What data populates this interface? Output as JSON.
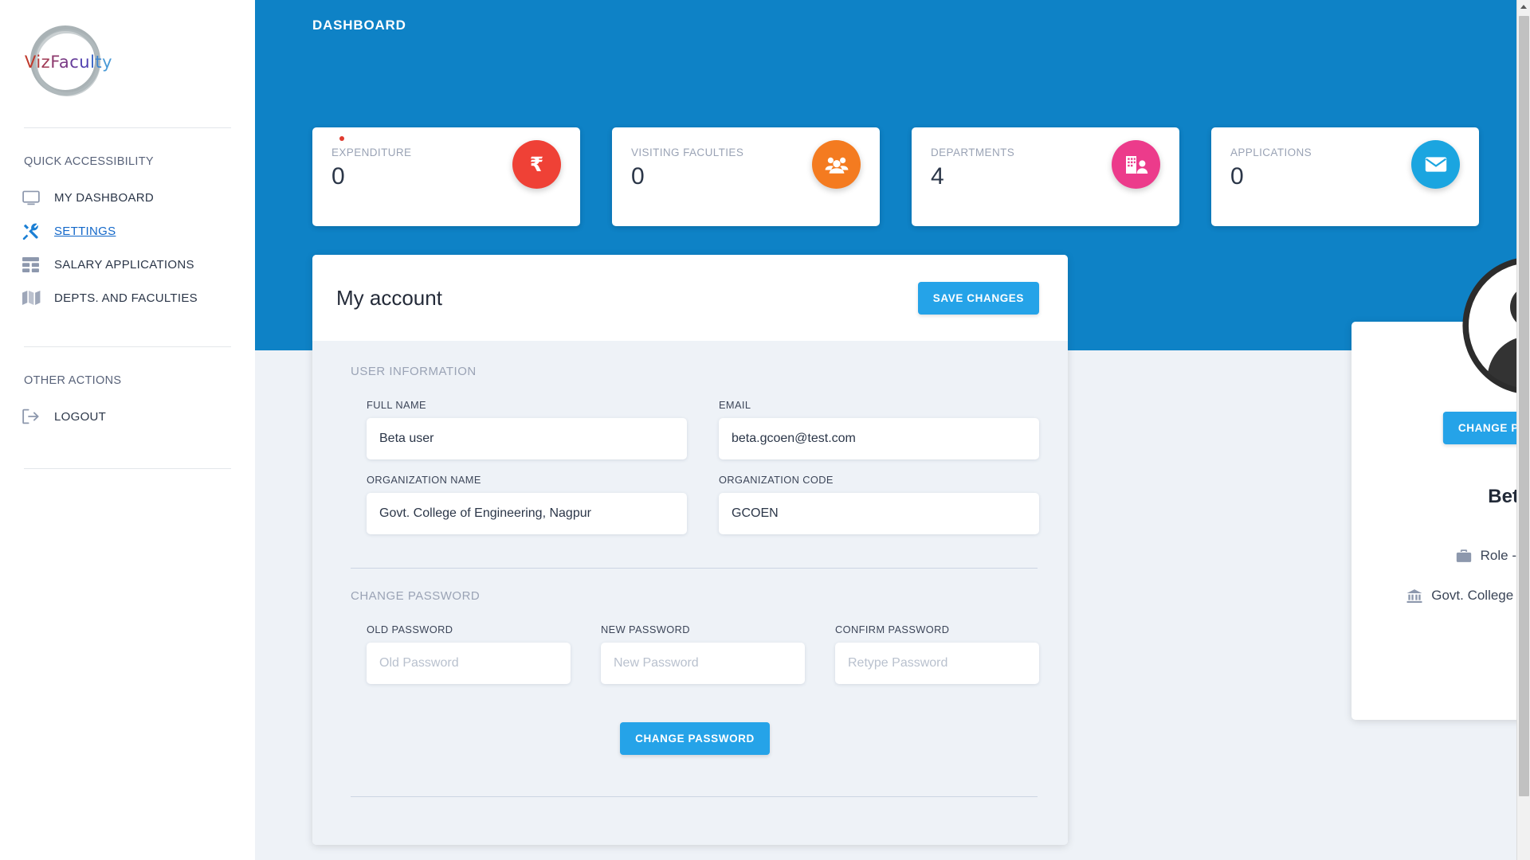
{
  "app": {
    "logo_text": "VizFaculty",
    "page_title": "DASHBOARD"
  },
  "sidebar": {
    "sections": [
      {
        "title": "QUICK ACCESSIBILITY"
      },
      {
        "title": "OTHER ACTIONS"
      }
    ],
    "quick_items": [
      {
        "label": "MY DASHBOARD",
        "icon": "monitor-icon",
        "active": false
      },
      {
        "label": "SETTINGS",
        "icon": "tools-icon",
        "active": true
      },
      {
        "label": "SALARY APPLICATIONS",
        "icon": "table-icon",
        "active": false
      },
      {
        "label": "DEPTS. AND FACULTIES",
        "icon": "map-icon",
        "active": false
      }
    ],
    "other_items": [
      {
        "label": "LOGOUT",
        "icon": "logout-icon",
        "active": false
      }
    ]
  },
  "stats": [
    {
      "label": "EXPENDITURE",
      "value": "0",
      "icon": "rupee-icon",
      "color": "#ef4136",
      "has_dot": true
    },
    {
      "label": "VISITING FACULTIES",
      "value": "0",
      "icon": "users-icon",
      "color": "#f47b20",
      "has_dot": false
    },
    {
      "label": "DEPARTMENTS",
      "value": "4",
      "icon": "building-icon",
      "color": "#ec3b8b",
      "has_dot": false
    },
    {
      "label": "APPLICATIONS",
      "value": "0",
      "icon": "envelope-icon",
      "color": "#1ba5e0",
      "has_dot": false
    }
  ],
  "account": {
    "title": "My account",
    "save_label": "SAVE CHANGES",
    "user_information_title": "USER INFORMATION",
    "fields": [
      {
        "label": "FULL NAME",
        "value": "Beta user",
        "placeholder": "Full Name"
      },
      {
        "label": "EMAIL",
        "value": "beta.gcoen@test.com",
        "placeholder": "Email"
      },
      {
        "label": "ORGANIZATION NAME",
        "value": "Govt. College of Engineering, Nagpur",
        "placeholder": "Organization Name"
      },
      {
        "label": "ORGANIZATION CODE",
        "value": "GCOEN",
        "placeholder": "Organization Code"
      }
    ],
    "change_password_title": "CHANGE PASSWORD",
    "password_fields": [
      {
        "label": "OLD PASSWORD",
        "value": "",
        "placeholder": "Old Password"
      },
      {
        "label": "NEW PASSWORD",
        "value": "",
        "placeholder": "New Password"
      },
      {
        "label": "CONFIRM PASSWORD",
        "value": "",
        "placeholder": "Retype Password"
      }
    ],
    "change_password_button": "CHANGE PASSWORD"
  },
  "profile": {
    "change_photo_label": "CHANGE PROFILE PHOTO",
    "name": "Beta user",
    "role_text": "Role - College Admin",
    "organization_text": "Govt. College of Engineering, Nagpur"
  },
  "colors": {
    "banner_blue": "#0e82c6",
    "button_blue": "#25a3e8",
    "page_bg": "#eef2f7",
    "accent_link": "#1368c9"
  }
}
